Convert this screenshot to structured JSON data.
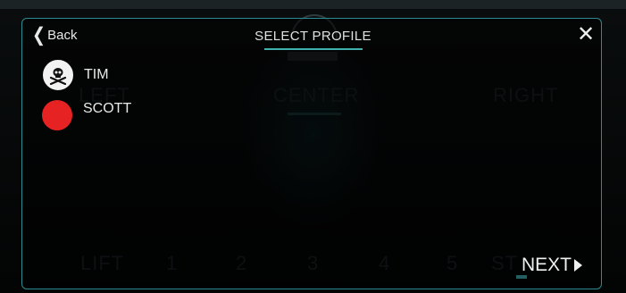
{
  "header": {
    "back_label": "Back",
    "title": "SELECT PROFILE",
    "close_icon": "close-icon"
  },
  "profiles": [
    {
      "name": "TIM",
      "avatar": "skull-icon"
    },
    {
      "name": "SCOTT",
      "avatar": "red-circle",
      "color": "#e72222"
    }
  ],
  "next_label": "NEXT",
  "colors": {
    "accent": "#2c8a90",
    "text": "#e8e8e8"
  }
}
